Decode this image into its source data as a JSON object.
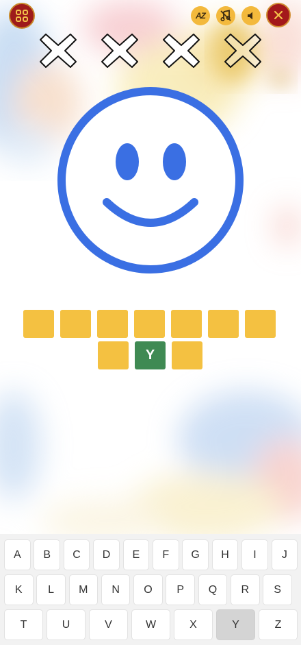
{
  "toolbar": {
    "menu_icon": "grid-menu-icon",
    "az_label": "AZ",
    "music_icon": "music-off-icon",
    "sound_icon": "speaker-icon",
    "close_icon": "close-icon"
  },
  "strikes": {
    "total": 4,
    "icon": "x-mark-icon"
  },
  "puzzle": {
    "image": "smiling-face-emoji",
    "emoji_color": "#3a6fe3"
  },
  "answer": {
    "row1": [
      "",
      "",
      "",
      "",
      "",
      "",
      ""
    ],
    "row2": [
      "",
      "Y",
      ""
    ],
    "tile_color": "#f4c141",
    "revealed_color": "#3f8a53"
  },
  "keyboard": {
    "row1": [
      "A",
      "B",
      "C",
      "D",
      "E",
      "F",
      "G",
      "H",
      "I",
      "J"
    ],
    "row2": [
      "K",
      "L",
      "M",
      "N",
      "O",
      "P",
      "Q",
      "R",
      "S"
    ],
    "row3": [
      "T",
      "U",
      "V",
      "W",
      "X",
      "Y",
      "Z"
    ],
    "used_keys": [
      "Y"
    ]
  }
}
